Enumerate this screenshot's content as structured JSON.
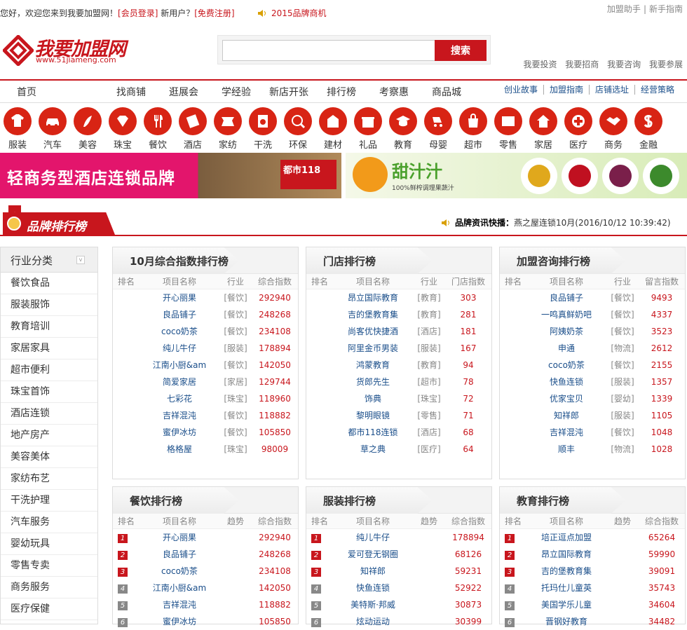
{
  "topbar": {
    "welcome": "您好，欢迎您来到我要加盟网！",
    "login": "[会员登录]",
    "new_user": "新用户？",
    "register": "[免费注册]",
    "announcement": "2015品牌商机",
    "helper": "加盟助手",
    "guide": "新手指南"
  },
  "logo": {
    "name": "我要加盟网",
    "url": "www.51jiameng.com"
  },
  "search": {
    "placeholder": "",
    "button": "搜索"
  },
  "quick_links": [
    "我要投资",
    "我要招商",
    "我要咨询",
    "我要参展"
  ],
  "nav": {
    "items": [
      "首页",
      "找商铺",
      "逛展会",
      "学经验",
      "新店开张",
      "排行榜",
      "考察惠",
      "商品城"
    ],
    "sub": [
      "创业故事",
      "加盟指南",
      "店铺选址",
      "经营策略"
    ]
  },
  "categories": [
    {
      "label": "服装",
      "icon": "tshirt-icon"
    },
    {
      "label": "汽车",
      "icon": "car-icon"
    },
    {
      "label": "美容",
      "icon": "beauty-icon"
    },
    {
      "label": "珠宝",
      "icon": "jewel-icon"
    },
    {
      "label": "餐饮",
      "icon": "cutlery-icon"
    },
    {
      "label": "酒店",
      "icon": "hotel-icon"
    },
    {
      "label": "家纺",
      "icon": "textile-icon"
    },
    {
      "label": "干洗",
      "icon": "washer-icon"
    },
    {
      "label": "环保",
      "icon": "globe-icon"
    },
    {
      "label": "建材",
      "icon": "building-icon"
    },
    {
      "label": "礼品",
      "icon": "gift-icon"
    },
    {
      "label": "教育",
      "icon": "graduation-icon"
    },
    {
      "label": "母婴",
      "icon": "stroller-icon"
    },
    {
      "label": "超市",
      "icon": "shopping-bag-icon"
    },
    {
      "label": "零售",
      "icon": "sold-tag-icon"
    },
    {
      "label": "家居",
      "icon": "house-icon"
    },
    {
      "label": "医疗",
      "icon": "medical-cross-icon"
    },
    {
      "label": "商务",
      "icon": "handshake-icon"
    },
    {
      "label": "金融",
      "icon": "dollar-icon"
    }
  ],
  "banners": {
    "left": {
      "text": "轻商务型酒店连锁品牌",
      "brand": "都市118"
    },
    "right": {
      "title": "甜汁汁",
      "sub": "100%鲜榨调理果蔬汁"
    }
  },
  "section": {
    "title": "品牌排行榜",
    "ticker_label": "品牌资讯快播：",
    "ticker_text": "燕之屋连锁10月(2016/10/12 10:39:42)"
  },
  "sidebar": {
    "title": "行业分类",
    "items": [
      "餐饮食品",
      "服装服饰",
      "教育培训",
      "家居家具",
      "超市便利",
      "珠宝首饰",
      "酒店连锁",
      "地产房产",
      "美容美体",
      "家纺布艺",
      "干洗护理",
      "汽车服务",
      "婴幼玩具",
      "零售专卖",
      "商务服务",
      "医疗保健"
    ]
  },
  "panels": [
    {
      "title": "10月综合指数排行榜",
      "cols": [
        "排名",
        "项目名称",
        "行业",
        "综合指数"
      ],
      "rows": [
        [
          "",
          "开心丽果",
          "[餐饮]",
          "292940"
        ],
        [
          "",
          "良品铺子",
          "[餐饮]",
          "248268"
        ],
        [
          "",
          "coco奶茶",
          "[餐饮]",
          "234108"
        ],
        [
          "",
          "纯儿牛仔",
          "[服装]",
          "178894"
        ],
        [
          "",
          "江南小厨&am",
          "[餐饮]",
          "142050"
        ],
        [
          "",
          "简爱家居",
          "[家居]",
          "129744"
        ],
        [
          "",
          "七彩花",
          "[珠宝]",
          "118960"
        ],
        [
          "",
          "吉祥混沌",
          "[餐饮]",
          "118882"
        ],
        [
          "",
          "蜜伊冰坊",
          "[餐饮]",
          "105850"
        ],
        [
          "",
          "格格屋",
          "[珠宝]",
          "98009"
        ]
      ]
    },
    {
      "title": "门店排行榜",
      "cols": [
        "排名",
        "项目名称",
        "行业",
        "门店指数"
      ],
      "rows": [
        [
          "",
          "昂立国际教育",
          "[教育]",
          "303"
        ],
        [
          "",
          "吉的堡教育集",
          "[教育]",
          "281"
        ],
        [
          "",
          "尚客优快捷酒",
          "[酒店]",
          "181"
        ],
        [
          "",
          "阿里金币男装",
          "[服装]",
          "167"
        ],
        [
          "",
          "鸿蒙教育",
          "[教育]",
          "94"
        ],
        [
          "",
          "货郎先生",
          "[超市]",
          "78"
        ],
        [
          "",
          "饰典",
          "[珠宝]",
          "72"
        ],
        [
          "",
          "黎明眼镜",
          "[零售]",
          "71"
        ],
        [
          "",
          "都市118连锁",
          "[酒店]",
          "68"
        ],
        [
          "",
          "草之典",
          "[医疗]",
          "64"
        ]
      ]
    },
    {
      "title": "加盟咨询排行榜",
      "cols": [
        "排名",
        "项目名称",
        "行业",
        "留言指数"
      ],
      "rows": [
        [
          "",
          "良品铺子",
          "[餐饮]",
          "9493"
        ],
        [
          "",
          "一鸣真鲜奶吧",
          "[餐饮]",
          "4337"
        ],
        [
          "",
          "阿姨奶茶",
          "[餐饮]",
          "3523"
        ],
        [
          "",
          "申通",
          "[物流]",
          "2612"
        ],
        [
          "",
          "coco奶茶",
          "[餐饮]",
          "2155"
        ],
        [
          "",
          "快鱼连锁",
          "[服装]",
          "1357"
        ],
        [
          "",
          "优家宝贝",
          "[婴幼]",
          "1339"
        ],
        [
          "",
          "知祥郎",
          "[服装]",
          "1105"
        ],
        [
          "",
          "吉祥混沌",
          "[餐饮]",
          "1048"
        ],
        [
          "",
          "顺丰",
          "[物流]",
          "1028"
        ]
      ]
    },
    {
      "title": "餐饮排行榜",
      "cols": [
        "排名",
        "项目名称",
        "趋势",
        "综合指数"
      ],
      "rows": [
        [
          "1",
          "开心丽果",
          "",
          "292940"
        ],
        [
          "2",
          "良品铺子",
          "",
          "248268"
        ],
        [
          "3",
          "coco奶茶",
          "",
          "234108"
        ],
        [
          "4",
          "江南小厨&am",
          "",
          "142050"
        ],
        [
          "5",
          "吉祥混沌",
          "",
          "118882"
        ],
        [
          "6",
          "蜜伊冰坊",
          "",
          "105850"
        ]
      ]
    },
    {
      "title": "服装排行榜",
      "cols": [
        "排名",
        "项目名称",
        "趋势",
        "综合指数"
      ],
      "rows": [
        [
          "1",
          "纯儿牛仔",
          "",
          "178894"
        ],
        [
          "2",
          "爱可登无钢圈",
          "",
          "68126"
        ],
        [
          "3",
          "知祥郎",
          "",
          "59231"
        ],
        [
          "4",
          "快鱼连锁",
          "",
          "52922"
        ],
        [
          "5",
          "美特斯·邦威",
          "",
          "30873"
        ],
        [
          "6",
          "炫动运动",
          "",
          "30399"
        ]
      ]
    },
    {
      "title": "教育排行榜",
      "cols": [
        "排名",
        "项目名称",
        "趋势",
        "综合指数"
      ],
      "rows": [
        [
          "1",
          "培正逗点加盟",
          "",
          "65264"
        ],
        [
          "2",
          "昂立国际教育",
          "",
          "59990"
        ],
        [
          "3",
          "吉的堡教育集",
          "",
          "39091"
        ],
        [
          "4",
          "托玛仕儿童英",
          "",
          "35743"
        ],
        [
          "5",
          "美国学乐儿童",
          "",
          "34604"
        ],
        [
          "6",
          "晋钢好教育",
          "",
          "34482"
        ]
      ]
    }
  ],
  "colors": {
    "brand_red": "#c8161d"
  }
}
